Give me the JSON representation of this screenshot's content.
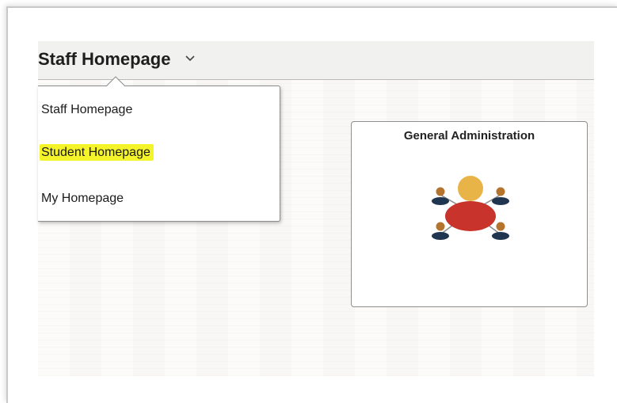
{
  "header": {
    "title": "Staff Homepage",
    "chevron_icon": "chevron-down-icon"
  },
  "dropdown": {
    "items": [
      {
        "label": "Staff Homepage",
        "highlighted": false
      },
      {
        "label": "Student Homepage",
        "highlighted": true
      },
      {
        "label": "My Homepage",
        "highlighted": false
      }
    ],
    "highlight_color": "#f5f32a"
  },
  "tiles": [
    {
      "title": "General Administration",
      "icon": "people-network-icon",
      "colors": {
        "center_head": "#e8b347",
        "center_body": "#c8332b",
        "satellite_head": "#b5742d",
        "satellite_body": "#1f3550"
      }
    }
  ]
}
